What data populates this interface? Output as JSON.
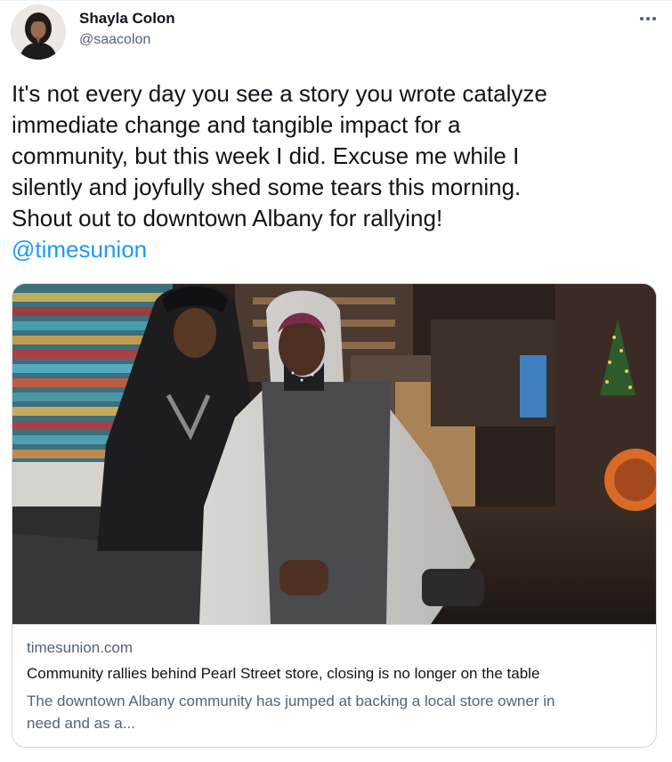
{
  "author": {
    "name": "Shayla Colon",
    "handle": "@saacolon"
  },
  "tweet": {
    "lines": [
      "It's not every day you see a story you wrote catalyze",
      "immediate change and tangible impact for a",
      "community, but this week I did. Excuse me while I",
      "silently and joyfully shed some tears this morning.",
      "Shout out to downtown Albany for rallying!"
    ],
    "mention": "@timesunion"
  },
  "card": {
    "domain": "timesunion.com",
    "title": "Community rallies behind Pearl Street store, closing is no longer on the table",
    "description_lines": [
      "The downtown Albany community has jumped at backing a local store owner in",
      "need and as a..."
    ]
  },
  "icons": {
    "more": "more-horizontal-icon"
  },
  "colors": {
    "link": "#1d9bf0",
    "secondary_text": "#536471",
    "primary_text": "#0f1419",
    "border": "#cfd9de"
  }
}
